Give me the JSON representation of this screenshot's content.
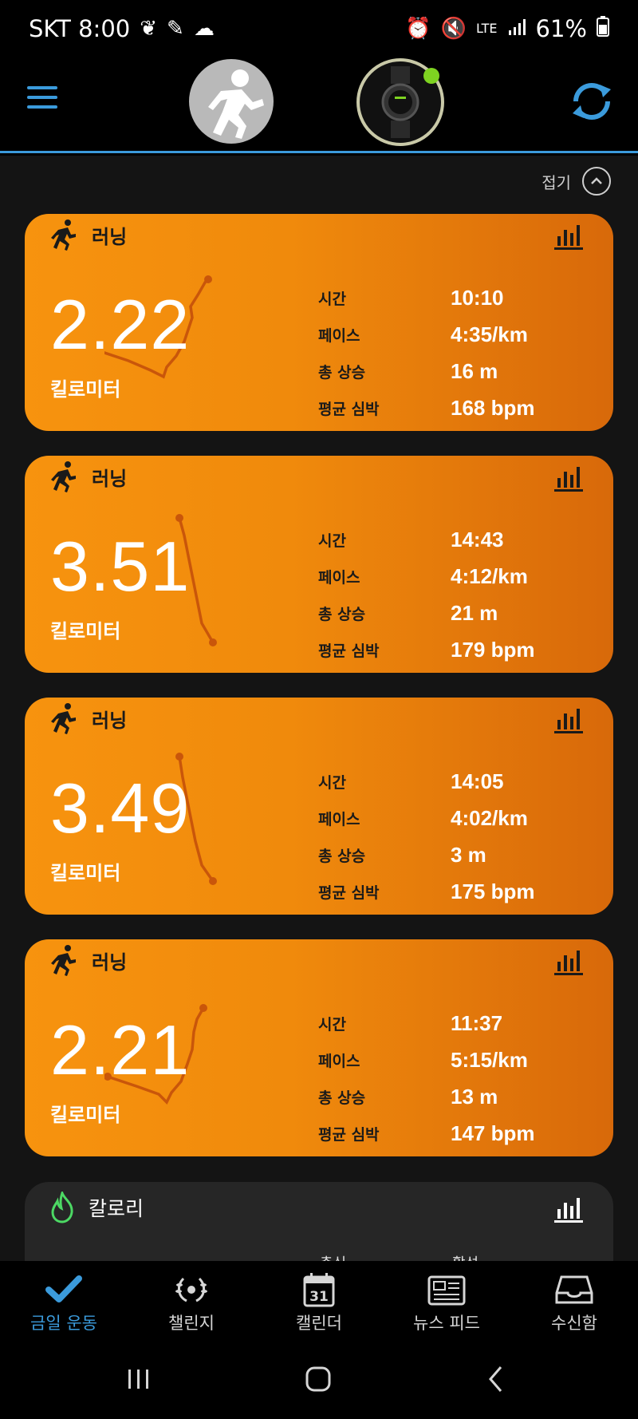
{
  "status_bar": {
    "carrier_time": "SKT 8:00",
    "network": "LTE",
    "battery": "61%"
  },
  "header": {
    "menu_icon": "hamburger-menu-icon",
    "avatar_icon": "runner-avatar-icon",
    "device_icon": "watch-device-icon",
    "sync_icon": "sync-icon"
  },
  "collapse_label": "접기",
  "activities": [
    {
      "type_label": "러닝",
      "distance": "2.22",
      "unit": "킬로미터",
      "stats": [
        {
          "label": "시간",
          "value": "10:10"
        },
        {
          "label": "페이스",
          "value": "4:35/km"
        },
        {
          "label": "총 상승",
          "value": "16 m"
        },
        {
          "label": "평균 심박",
          "value": "168 bpm"
        }
      ]
    },
    {
      "type_label": "러닝",
      "distance": "3.51",
      "unit": "킬로미터",
      "stats": [
        {
          "label": "시간",
          "value": "14:43"
        },
        {
          "label": "페이스",
          "value": "4:12/km"
        },
        {
          "label": "총 상승",
          "value": "21 m"
        },
        {
          "label": "평균 심박",
          "value": "179 bpm"
        }
      ]
    },
    {
      "type_label": "러닝",
      "distance": "3.49",
      "unit": "킬로미터",
      "stats": [
        {
          "label": "시간",
          "value": "14:05"
        },
        {
          "label": "페이스",
          "value": "4:02/km"
        },
        {
          "label": "총 상승",
          "value": "3 m"
        },
        {
          "label": "평균 심박",
          "value": "175 bpm"
        }
      ]
    },
    {
      "type_label": "러닝",
      "distance": "2.21",
      "unit": "킬로미터",
      "stats": [
        {
          "label": "시간",
          "value": "11:37"
        },
        {
          "label": "페이스",
          "value": "5:15/km"
        },
        {
          "label": "총 상승",
          "value": "13 m"
        },
        {
          "label": "평균 심박",
          "value": "147 bpm"
        }
      ]
    }
  ],
  "calorie_card": {
    "label": "칼로리",
    "peek_left": "총식",
    "peek_right": "활성"
  },
  "bottom_nav": [
    {
      "label": "금일 운동",
      "icon": "checkmark-icon"
    },
    {
      "label": "챌린지",
      "icon": "laurel-icon"
    },
    {
      "label": "캘린더",
      "icon": "calendar-icon",
      "day": "31"
    },
    {
      "label": "뉴스 피드",
      "icon": "newspaper-icon"
    },
    {
      "label": "수신함",
      "icon": "inbox-icon"
    }
  ],
  "colors": {
    "accent": "#3b9bdc",
    "card_orange": "#f7930e",
    "card_orange_dark": "#d8690a",
    "route": "#c9560a",
    "calorie_green": "#4cd964",
    "status_dot": "#7ed321"
  }
}
